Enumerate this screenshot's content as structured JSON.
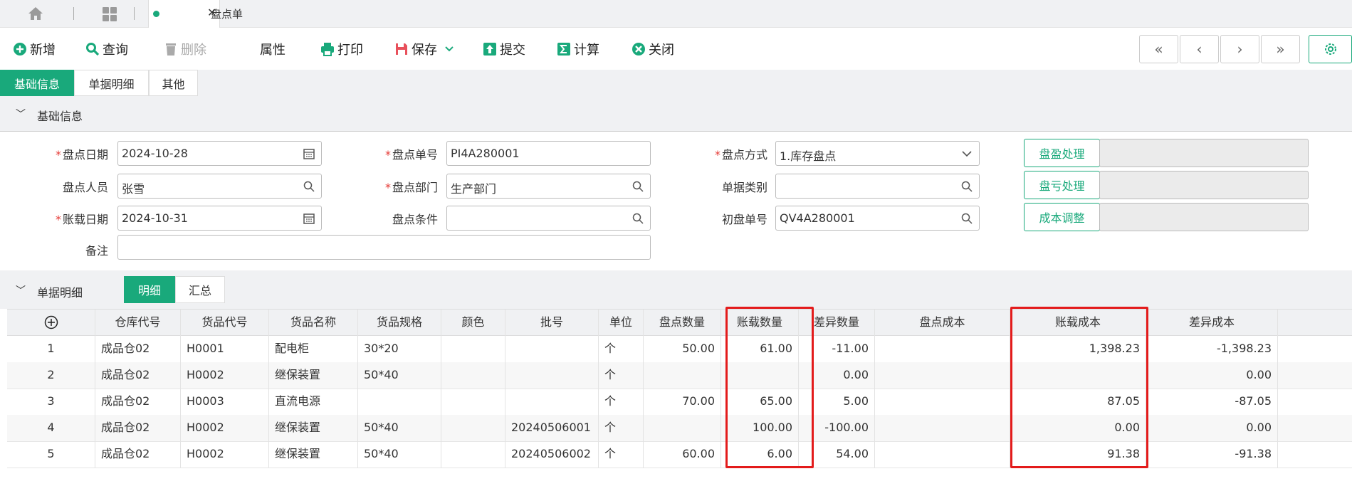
{
  "tabs": {
    "active_label": "盘点单",
    "close_label": "✕"
  },
  "toolbar": {
    "add": "新增",
    "query": "查询",
    "delete": "删除",
    "props": "属性",
    "print": "打印",
    "save": "保存",
    "submit": "提交",
    "calc": "计算",
    "close": "关闭",
    "first": "«",
    "prev": "‹",
    "next": "›",
    "last": "»"
  },
  "section_tabs": [
    "基础信息",
    "单据明细",
    "其他"
  ],
  "basic_section": {
    "title": "基础信息"
  },
  "form": {
    "date_label": "盘点日期",
    "date_value": "2024-10-28",
    "no_label": "盘点单号",
    "no_value": "PI4A280001",
    "method_label": "盘点方式",
    "method_value": "1.库存盘点",
    "person_label": "盘点人员",
    "person_value": "张雪",
    "dept_label": "盘点部门",
    "dept_value": "生产部门",
    "doctype_label": "单据类别",
    "doctype_value": "",
    "acct_date_label": "账载日期",
    "acct_date_value": "2024-10-31",
    "cond_label": "盘点条件",
    "cond_value": "",
    "init_no_label": "初盘单号",
    "init_no_value": "QV4A280001",
    "remark_label": "备注",
    "remark_value": "",
    "btn_surplus": "盘盈处理",
    "btn_loss": "盘亏处理",
    "btn_cost": "成本调整"
  },
  "detail_section": {
    "title": "单据明细",
    "tab_detail": "明细",
    "tab_summary": "汇总"
  },
  "table": {
    "add_icon": "⊕",
    "columns": [
      "仓库代号",
      "货品代号",
      "货品名称",
      "货品规格",
      "颜色",
      "批号",
      "单位",
      "盘点数量",
      "账载数量",
      "差异数量",
      "盘点成本",
      "账载成本",
      "差异成本"
    ],
    "rows": [
      {
        "idx": "1",
        "wh": "成品仓02",
        "code": "H0001",
        "name": "配电柜",
        "spec": "30*20",
        "color": "",
        "batch": "",
        "unit": "个",
        "qty": "50.00",
        "book_qty": "61.00",
        "diff_qty": "-11.00",
        "cost": "",
        "book_cost": "1,398.23",
        "diff_cost": "-1,398.23"
      },
      {
        "idx": "2",
        "wh": "成品仓02",
        "code": "H0002",
        "name": "继保装置",
        "spec": "50*40",
        "color": "",
        "batch": "",
        "unit": "个",
        "qty": "",
        "book_qty": "",
        "diff_qty": "0.00",
        "cost": "",
        "book_cost": "",
        "diff_cost": "0.00"
      },
      {
        "idx": "3",
        "wh": "成品仓02",
        "code": "H0003",
        "name": "直流电源",
        "spec": "",
        "color": "",
        "batch": "",
        "unit": "个",
        "qty": "70.00",
        "book_qty": "65.00",
        "diff_qty": "5.00",
        "cost": "",
        "book_cost": "87.05",
        "diff_cost": "-87.05"
      },
      {
        "idx": "4",
        "wh": "成品仓02",
        "code": "H0002",
        "name": "继保装置",
        "spec": "50*40",
        "color": "",
        "batch": "20240506001",
        "unit": "个",
        "qty": "",
        "book_qty": "100.00",
        "diff_qty": "-100.00",
        "cost": "",
        "book_cost": "0.00",
        "diff_cost": "0.00"
      },
      {
        "idx": "5",
        "wh": "成品仓02",
        "code": "H0002",
        "name": "继保装置",
        "spec": "50*40",
        "color": "",
        "batch": "20240506002",
        "unit": "个",
        "qty": "60.00",
        "book_qty": "6.00",
        "diff_qty": "54.00",
        "cost": "",
        "book_cost": "91.38",
        "diff_cost": "-91.38"
      }
    ]
  },
  "colors": {
    "accent": "#19a97b",
    "highlight": "#e31b1b"
  }
}
